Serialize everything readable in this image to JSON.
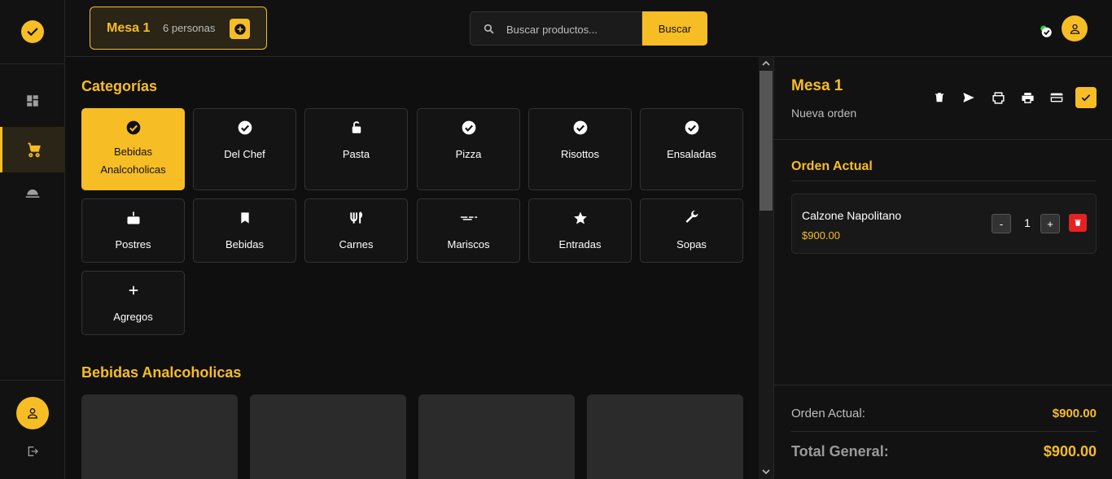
{
  "topbar": {
    "table_name": "Mesa 1",
    "people": "6 personas",
    "search_placeholder": "Buscar productos...",
    "search_button": "Buscar"
  },
  "sidebar": {
    "items": [
      {
        "icon": "dashboard-icon"
      },
      {
        "icon": "cart-icon",
        "active": true
      },
      {
        "icon": "room-service-icon"
      }
    ]
  },
  "categories": {
    "title": "Categorías",
    "items": [
      {
        "label": "Bebidas Analcoholicas",
        "icon": "check-circle-icon",
        "active": true
      },
      {
        "label": "Del Chef",
        "icon": "check-circle-icon"
      },
      {
        "label": "Pasta",
        "icon": "lock-open-icon"
      },
      {
        "label": "Pizza",
        "icon": "check-circle-icon"
      },
      {
        "label": "Risottos",
        "icon": "check-circle-icon"
      },
      {
        "label": "Ensaladas",
        "icon": "check-circle-icon"
      },
      {
        "label": "Postres",
        "icon": "cake-icon"
      },
      {
        "label": "Bebidas",
        "icon": "bookmark-icon"
      },
      {
        "label": "Carnes",
        "icon": "utensils-icon"
      },
      {
        "label": "Mariscos",
        "icon": "fish-icon"
      },
      {
        "label": "Entradas",
        "icon": "star-icon"
      },
      {
        "label": "Sopas",
        "icon": "wrench-icon"
      },
      {
        "label": "Agregos",
        "icon": "plus-icon"
      }
    ]
  },
  "products": {
    "title": "Bebidas Analcoholicas"
  },
  "panel": {
    "title": "Mesa 1",
    "subtitle": "Nueva orden",
    "order_label": "Orden Actual",
    "items": [
      {
        "name": "Calzone Napolitano",
        "price": "$900.00",
        "qty": "1"
      }
    ],
    "subtotal_label": "Orden Actual:",
    "subtotal_value": "$900.00",
    "total_label": "Total General:",
    "total_value": "$900.00"
  },
  "colors": {
    "accent": "#f7bd24",
    "danger": "#e52222",
    "background": "#0f0f0f"
  }
}
